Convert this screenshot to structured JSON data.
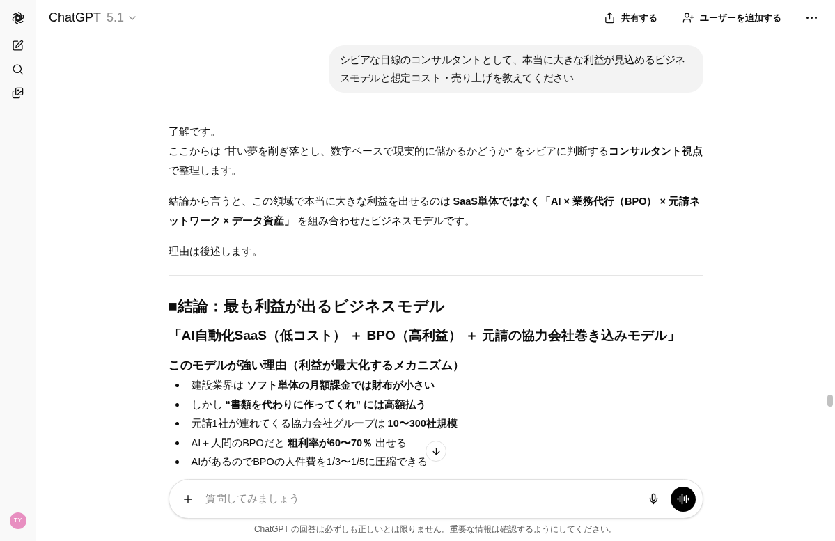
{
  "header": {
    "title": "ChatGPT",
    "version": "5.1",
    "actions": [
      {
        "kind": "share",
        "label": "共有する"
      },
      {
        "kind": "add-user",
        "label": "ユーザーを追加する"
      }
    ]
  },
  "user_message": "シビアな目線のコンサルタントとして、本当に大きな利益が見込めるビジネスモデルと想定コスト・売り上げを教えてください",
  "assistant": {
    "paragraphs": [
      {
        "lines": [
          "了解です。",
          "ここからは “甘い夢を削ぎ落とし、数字ベースで現実的に儲かるかどうか” をシビアに判断する**コンサルタント視点**で整理します。"
        ]
      },
      {
        "lines": [
          "結論から言うと、この領域で本当に大きな利益を出せるのは **SaaS単体ではなく「AI × 業務代行（BPO） × 元請ネットワーク × データ資産」** を組み合わせたビジネスモデルです。"
        ]
      },
      {
        "lines": [
          "理由は後述します。"
        ]
      }
    ],
    "heading": "■結論：最も利益が出るビジネスモデル",
    "subheading": "「AI自動化SaaS（低コスト） ＋ BPO（高利益） ＋ 元請の協力会社巻き込みモデル」",
    "section_title": "このモデルが強い理由（利益が最大化するメカニズム）",
    "bullets": [
      "建設業界は **ソフト単体の月額課金では財布が小さい**",
      "しかし **“書類を代わりに作ってくれ” には高額払う**",
      "元請1社が連れてくる協力会社グループは **10〜300社規模**",
      "AI＋人間のBPOだと **粗利率が60〜70％** 出せる",
      "AIがあるのでBPOの人件費を1/3〜1/5に圧縮できる"
    ]
  },
  "composer": {
    "placeholder": "質問してみましょう"
  },
  "disclaimer": "ChatGPT の回答は必ずしも正しいとは限りません。重要な情報は確認するようにしてください。",
  "avatar": {
    "initials": "TY"
  }
}
